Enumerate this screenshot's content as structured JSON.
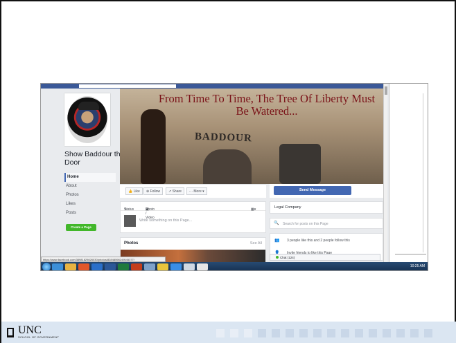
{
  "facebook_page": {
    "page_name": "Show Baddour the Door",
    "nav": [
      "Home",
      "About",
      "Photos",
      "Likes",
      "Posts"
    ],
    "create_page_label": "Create a Page",
    "cover": {
      "title": "From Time To Time, The Tree Of Liberty Must Be Watered...",
      "sign_text": "BADDOUR"
    },
    "actions": {
      "like": "Like",
      "follow": "Follow",
      "share": "Share",
      "more": "More",
      "send_message": "Send Message"
    },
    "composer": {
      "status_tab": "Status",
      "photo_video_tab": "Photo / Video",
      "placeholder": "Write something on this Page..."
    },
    "photos": {
      "title": "Photos",
      "see_all": "See All"
    },
    "sidebar": {
      "category": "Legal Company",
      "search_placeholder": "Search for posts on this Page",
      "likes_text": "3 people like this and 2 people follow this",
      "invite_text": "Invite friends to like this Page"
    },
    "chat_label": "Chat (124)",
    "status_url": "https://www.facebook.com/38981829826030/photos/82848598249545377/"
  },
  "taskbar": {
    "clock": "10:25 AM"
  },
  "footer": {
    "org": "UNC",
    "org_sub": "SCHOOL OF GOVERNMENT"
  }
}
